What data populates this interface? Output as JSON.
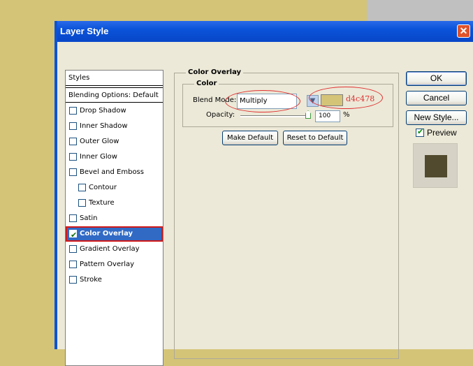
{
  "dialog": {
    "title": "Layer Style",
    "close_glyph": "✕"
  },
  "styles_list": {
    "header": "Styles",
    "blending": "Blending Options: Default",
    "items": [
      {
        "label": "Drop Shadow",
        "checked": false
      },
      {
        "label": "Inner Shadow",
        "checked": false
      },
      {
        "label": "Outer Glow",
        "checked": false
      },
      {
        "label": "Inner Glow",
        "checked": false
      },
      {
        "label": "Bevel and Emboss",
        "checked": false
      },
      {
        "label": "Contour",
        "checked": false
      },
      {
        "label": "Texture",
        "checked": false
      },
      {
        "label": "Satin",
        "checked": false
      },
      {
        "label": "Color Overlay",
        "checked": true,
        "selected": true
      },
      {
        "label": "Gradient Overlay",
        "checked": false
      },
      {
        "label": "Pattern Overlay",
        "checked": false
      },
      {
        "label": "Stroke",
        "checked": false
      }
    ]
  },
  "panel": {
    "group_title": "Color Overlay",
    "subgroup_title": "Color",
    "blend_mode_label": "Blend Mode:",
    "blend_mode_value": "Multiply",
    "overlay_color": "#d4c478",
    "color_note": "d4c478",
    "opacity_label": "Opacity:",
    "opacity_value": "100",
    "opacity_unit": "%",
    "opacity_level": 1.0,
    "make_default_label": "Make Default",
    "reset_default_label": "Reset to Default"
  },
  "actions": {
    "ok_label": "OK",
    "cancel_label": "Cancel",
    "new_style_label": "New Style...",
    "preview_label": "Preview",
    "preview_checked": true
  },
  "colors": {
    "canvas_background": "#d4c478",
    "selection": "#316ac5",
    "annotation": "#e03030",
    "preview_swatch": "#524a2e"
  }
}
